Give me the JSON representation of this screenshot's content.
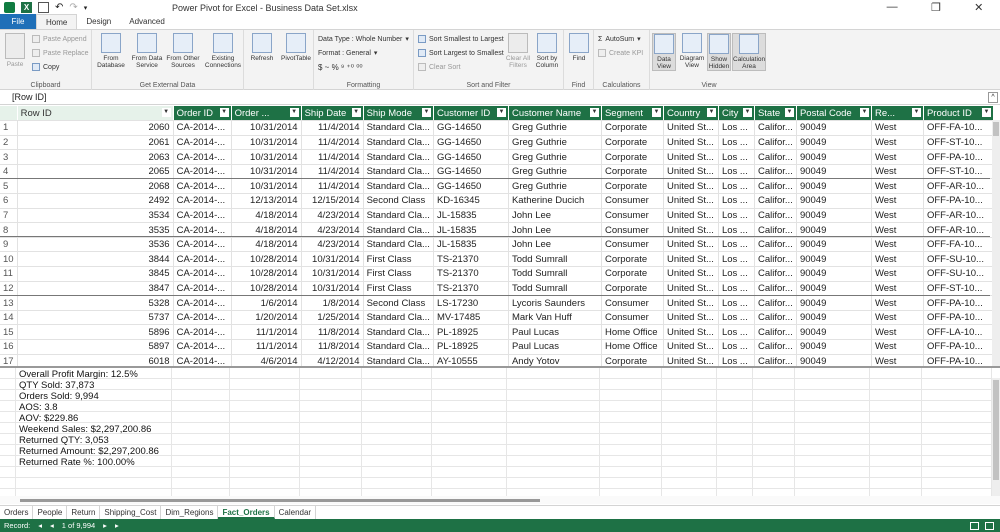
{
  "window": {
    "title": "Power Pivot for Excel - Business Data Set.xlsx",
    "minimize": "—",
    "restore": "❐",
    "close": "✕"
  },
  "ribbon_tabs": [
    "File",
    "Home",
    "Design",
    "Advanced"
  ],
  "ribbon": {
    "clipboard": {
      "label": "Clipboard",
      "paste": "Paste",
      "paste_append": "Paste Append",
      "paste_replace": "Paste Replace",
      "copy": "Copy"
    },
    "external": {
      "label": "Get External Data",
      "from_database": "From Database",
      "from_data_service": "From Data Service",
      "from_other_sources": "From Other Sources",
      "existing_connections": "Existing Connections"
    },
    "refresh": "Refresh",
    "pivottable": "PivotTable",
    "formatting": {
      "label": "Formatting",
      "data_type": "Data Type : Whole Number",
      "format": "Format : General",
      "symbols": "$ ~ % ⁹ ⁺⁰ ⁰⁰"
    },
    "sortfilter": {
      "label": "Sort and Filter",
      "sort_smallest": "Sort Smallest to Largest",
      "sort_largest": "Sort Largest to Smallest",
      "clear_sort": "Clear Sort",
      "clear_all_filters": "Clear All Filters",
      "sort_by_column": "Sort by Column"
    },
    "find": {
      "label": "Find",
      "find": "Find"
    },
    "calculations": {
      "label": "Calculations",
      "autosum": "AutoSum",
      "create_kpi": "Create KPI"
    },
    "view": {
      "label": "View",
      "data_view": "Data View",
      "diagram_view": "Diagram View",
      "show_hidden": "Show Hidden",
      "calculation_area": "Calculation Area"
    }
  },
  "formula_bar": {
    "name": "[Row ID]"
  },
  "table": {
    "columns": [
      "Row ID",
      "Order ID",
      "Order ...",
      "Ship Date",
      "Ship Mode",
      "Customer ID",
      "Customer Name",
      "Segment",
      "Country",
      "City",
      "State",
      "Postal Code",
      "Re...",
      "Product ID"
    ],
    "rows": [
      [
        "1",
        "2060",
        "CA-2014-...",
        "10/31/2014",
        "11/4/2014",
        "Standard Cla...",
        "GG-14650",
        "Greg Guthrie",
        "Corporate",
        "United St...",
        "Los ...",
        "Califor...",
        "90049",
        "West",
        "OFF-FA-10..."
      ],
      [
        "2",
        "2061",
        "CA-2014-...",
        "10/31/2014",
        "11/4/2014",
        "Standard Cla...",
        "GG-14650",
        "Greg Guthrie",
        "Corporate",
        "United St...",
        "Los ...",
        "Califor...",
        "90049",
        "West",
        "OFF-ST-10..."
      ],
      [
        "3",
        "2063",
        "CA-2014-...",
        "10/31/2014",
        "11/4/2014",
        "Standard Cla...",
        "GG-14650",
        "Greg Guthrie",
        "Corporate",
        "United St...",
        "Los ...",
        "Califor...",
        "90049",
        "West",
        "OFF-PA-10..."
      ],
      [
        "4",
        "2065",
        "CA-2014-...",
        "10/31/2014",
        "11/4/2014",
        "Standard Cla...",
        "GG-14650",
        "Greg Guthrie",
        "Corporate",
        "United St...",
        "Los ...",
        "Califor...",
        "90049",
        "West",
        "OFF-ST-10..."
      ],
      [
        "5",
        "2068",
        "CA-2014-...",
        "10/31/2014",
        "11/4/2014",
        "Standard Cla...",
        "GG-14650",
        "Greg Guthrie",
        "Corporate",
        "United St...",
        "Los ...",
        "Califor...",
        "90049",
        "West",
        "OFF-AR-10..."
      ],
      [
        "6",
        "2492",
        "CA-2014-...",
        "12/13/2014",
        "12/15/2014",
        "Second Class",
        "KD-16345",
        "Katherine Ducich",
        "Consumer",
        "United St...",
        "Los ...",
        "Califor...",
        "90049",
        "West",
        "OFF-PA-10..."
      ],
      [
        "7",
        "3534",
        "CA-2014-...",
        "4/18/2014",
        "4/23/2014",
        "Standard Cla...",
        "JL-15835",
        "John Lee",
        "Consumer",
        "United St...",
        "Los ...",
        "Califor...",
        "90049",
        "West",
        "OFF-AR-10..."
      ],
      [
        "8",
        "3535",
        "CA-2014-...",
        "4/18/2014",
        "4/23/2014",
        "Standard Cla...",
        "JL-15835",
        "John Lee",
        "Consumer",
        "United St...",
        "Los ...",
        "Califor...",
        "90049",
        "West",
        "OFF-AR-10..."
      ],
      [
        "9",
        "3536",
        "CA-2014-...",
        "4/18/2014",
        "4/23/2014",
        "Standard Cla...",
        "JL-15835",
        "John Lee",
        "Consumer",
        "United St...",
        "Los ...",
        "Califor...",
        "90049",
        "West",
        "OFF-FA-10..."
      ],
      [
        "10",
        "3844",
        "CA-2014-...",
        "10/28/2014",
        "10/31/2014",
        "First Class",
        "TS-21370",
        "Todd Sumrall",
        "Corporate",
        "United St...",
        "Los ...",
        "Califor...",
        "90049",
        "West",
        "OFF-SU-10..."
      ],
      [
        "11",
        "3845",
        "CA-2014-...",
        "10/28/2014",
        "10/31/2014",
        "First Class",
        "TS-21370",
        "Todd Sumrall",
        "Corporate",
        "United St...",
        "Los ...",
        "Califor...",
        "90049",
        "West",
        "OFF-SU-10..."
      ],
      [
        "12",
        "3847",
        "CA-2014-...",
        "10/28/2014",
        "10/31/2014",
        "First Class",
        "TS-21370",
        "Todd Sumrall",
        "Corporate",
        "United St...",
        "Los ...",
        "Califor...",
        "90049",
        "West",
        "OFF-ST-10..."
      ],
      [
        "13",
        "5328",
        "CA-2014-...",
        "1/6/2014",
        "1/8/2014",
        "Second Class",
        "LS-17230",
        "Lycoris Saunders",
        "Consumer",
        "United St...",
        "Los ...",
        "Califor...",
        "90049",
        "West",
        "OFF-PA-10..."
      ],
      [
        "14",
        "5737",
        "CA-2014-...",
        "1/20/2014",
        "1/25/2014",
        "Standard Cla...",
        "MV-17485",
        "Mark Van Huff",
        "Consumer",
        "United St...",
        "Los ...",
        "Califor...",
        "90049",
        "West",
        "OFF-PA-10..."
      ],
      [
        "15",
        "5896",
        "CA-2014-...",
        "11/1/2014",
        "11/8/2014",
        "Standard Cla...",
        "PL-18925",
        "Paul Lucas",
        "Home Office",
        "United St...",
        "Los ...",
        "Califor...",
        "90049",
        "West",
        "OFF-LA-10..."
      ],
      [
        "16",
        "5897",
        "CA-2014-...",
        "11/1/2014",
        "11/8/2014",
        "Standard Cla...",
        "PL-18925",
        "Paul Lucas",
        "Home Office",
        "United St...",
        "Los ...",
        "Califor...",
        "90049",
        "West",
        "OFF-PA-10..."
      ],
      [
        "17",
        "6018",
        "CA-2014-...",
        "4/6/2014",
        "4/12/2014",
        "Standard Cla...",
        "AY-10555",
        "Andy Yotov",
        "Corporate",
        "United St...",
        "Los ...",
        "Califor...",
        "90049",
        "West",
        "OFF-PA-10..."
      ]
    ]
  },
  "measures": [
    "Overall Profit Margin: 12.5%",
    "QTY Sold: 37,873",
    "Orders Sold: 9,994",
    "AOS: 3.8",
    "AOV: $229.86",
    "Weekend Sales: $2,297,200.86",
    "Returned QTY: 3,053",
    "Returned Amount: $2,297,200.86",
    "Returned Rate %: 100.00%"
  ],
  "sheet_tabs": [
    "Orders",
    "People",
    "Return",
    "Shipping_Cost",
    "Dim_Regions",
    "Fact_Orders",
    "Calendar"
  ],
  "active_sheet": "Fact_Orders",
  "status": {
    "record_label": "Record:",
    "record_value": "1 of 9,994"
  },
  "colors": {
    "accent_green": "#1e7145",
    "file_tab_blue": "#1f6fb8"
  }
}
